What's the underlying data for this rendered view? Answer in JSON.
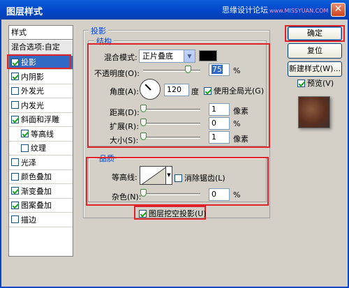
{
  "window": {
    "title": "图层样式",
    "watermark": "思缘设计论坛",
    "watermark_sub": "www.MISSYUAN.COM",
    "close_glyph": "✕"
  },
  "style_list": {
    "header": "样式",
    "blend_options": "混合选项:自定",
    "items": [
      {
        "label": "投影",
        "checked": true,
        "selected": true
      },
      {
        "label": "内阴影",
        "checked": true
      },
      {
        "label": "外发光",
        "checked": false
      },
      {
        "label": "内发光",
        "checked": false
      },
      {
        "label": "斜面和浮雕",
        "checked": true
      },
      {
        "label": "等高线",
        "checked": true,
        "indent": true
      },
      {
        "label": "纹理",
        "checked": false,
        "indent": true
      },
      {
        "label": "光泽",
        "checked": false
      },
      {
        "label": "颜色叠加",
        "checked": false
      },
      {
        "label": "渐变叠加",
        "checked": true
      },
      {
        "label": "图案叠加",
        "checked": true
      },
      {
        "label": "描边",
        "checked": false
      }
    ]
  },
  "drop_shadow": {
    "legend": "投影",
    "structure": {
      "legend": "结构",
      "blend_mode_label": "混合模式:",
      "blend_mode_value": "正片叠底",
      "shadow_color": "#000000",
      "opacity_label": "不透明度(O):",
      "opacity_value": "75",
      "opacity_unit": "%",
      "angle_label": "角度(A):",
      "angle_value": "120",
      "angle_unit": "度",
      "global_light_label": "使用全局光(G)",
      "global_light_checked": true,
      "distance_label": "距离(D):",
      "distance_value": "1",
      "distance_unit": "像素",
      "spread_label": "扩展(R):",
      "spread_value": "0",
      "spread_unit": "%",
      "size_label": "大小(S):",
      "size_value": "1",
      "size_unit": "像素"
    },
    "quality": {
      "legend": "品质",
      "contour_label": "等高线:",
      "antialias_label": "消除锯齿(L)",
      "antialias_checked": false,
      "noise_label": "杂色(N):",
      "noise_value": "0",
      "noise_unit": "%"
    },
    "knockout_label": "图层挖空投影(U)",
    "knockout_checked": true
  },
  "buttons": {
    "ok": "确定",
    "reset": "复位",
    "new_style": "新建样式(W)...",
    "preview_label": "预览(V)",
    "preview_checked": true
  }
}
